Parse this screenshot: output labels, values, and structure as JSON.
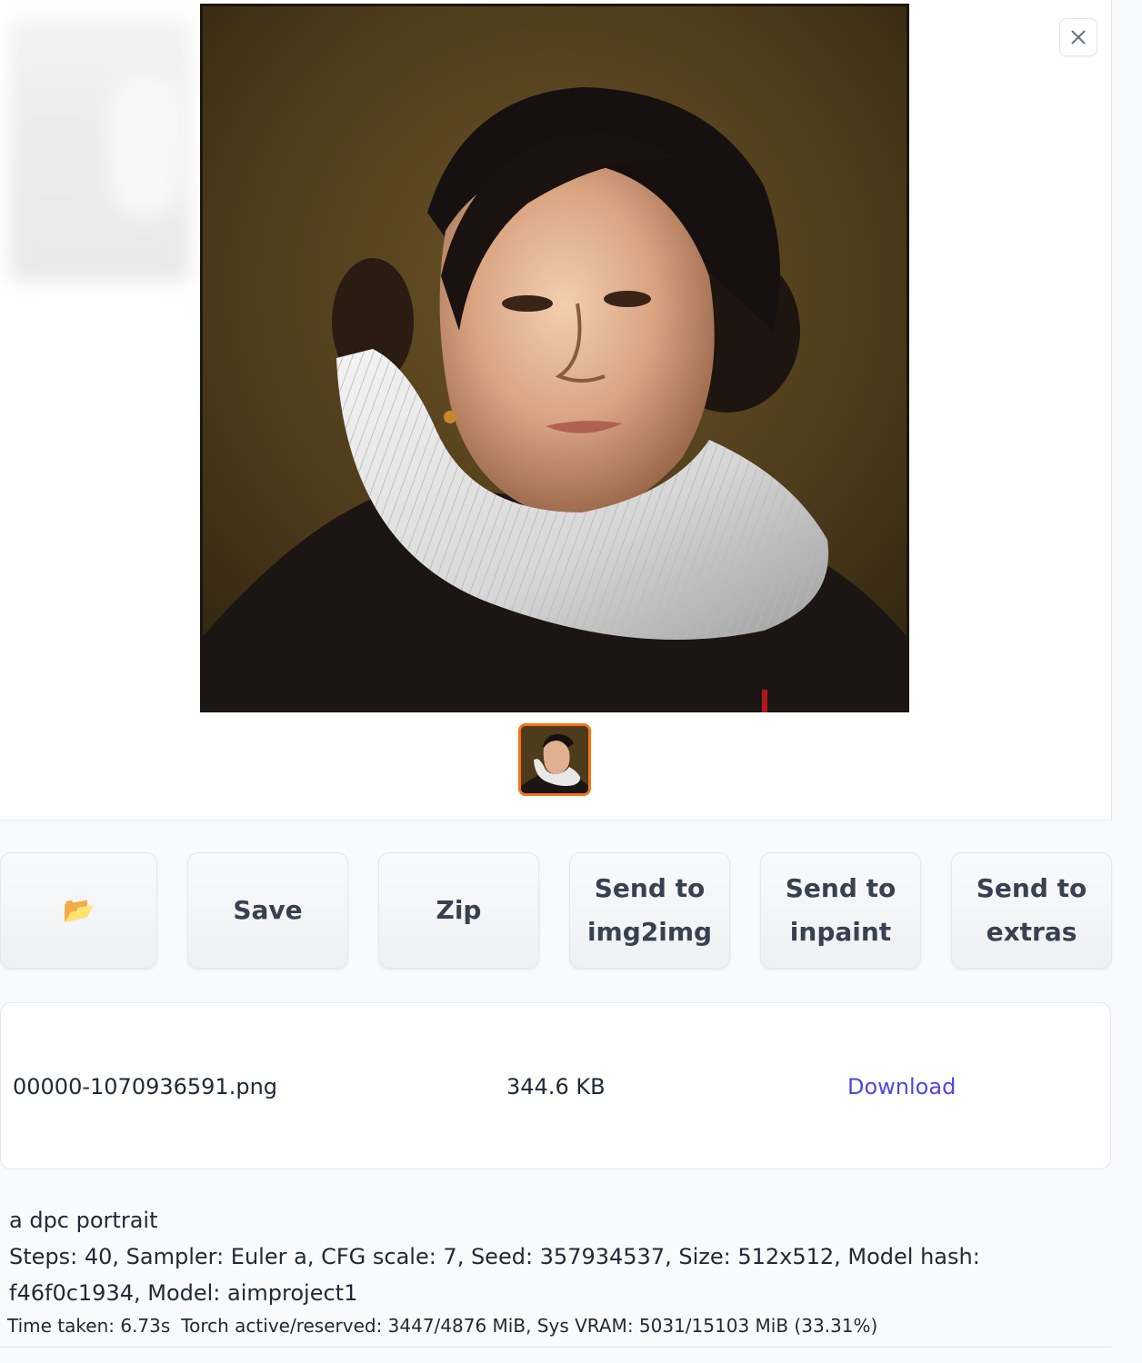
{
  "gallery": {
    "main_image": "portrait-painting-ruff-collar",
    "thumbnail": "portrait-thumbnail",
    "close_icon": "close-icon"
  },
  "actions": {
    "open_folder_icon": "folder-icon",
    "open_folder_glyph": "📂",
    "save_label": "Save",
    "zip_label": "Zip",
    "send_img2img_label": "Send to img2img",
    "send_inpaint_label": "Send to inpaint",
    "send_extras_label": "Send to extras"
  },
  "files": [
    {
      "name": "00000-1070936591.png",
      "size": "344.6 KB",
      "link_label": "Download"
    }
  ],
  "generation": {
    "prompt": "a dpc portrait",
    "params": "Steps: 40, Sampler: Euler a, CFG scale: 7, Seed: 357934537, Size: 512x512, Model hash: f46f0c1934, Model: aimproject1",
    "time_taken": "Time taken: 6.73s",
    "torch_memory": "Torch active/reserved: 3447/4876 MiB, Sys VRAM: 5031/15103 MiB (33.31%)"
  },
  "colors": {
    "accent_link": "#4f46e5",
    "selected_thumb_border": "#f97316",
    "panel_bg": "#ffffff",
    "page_bg": "#f9fafb"
  }
}
